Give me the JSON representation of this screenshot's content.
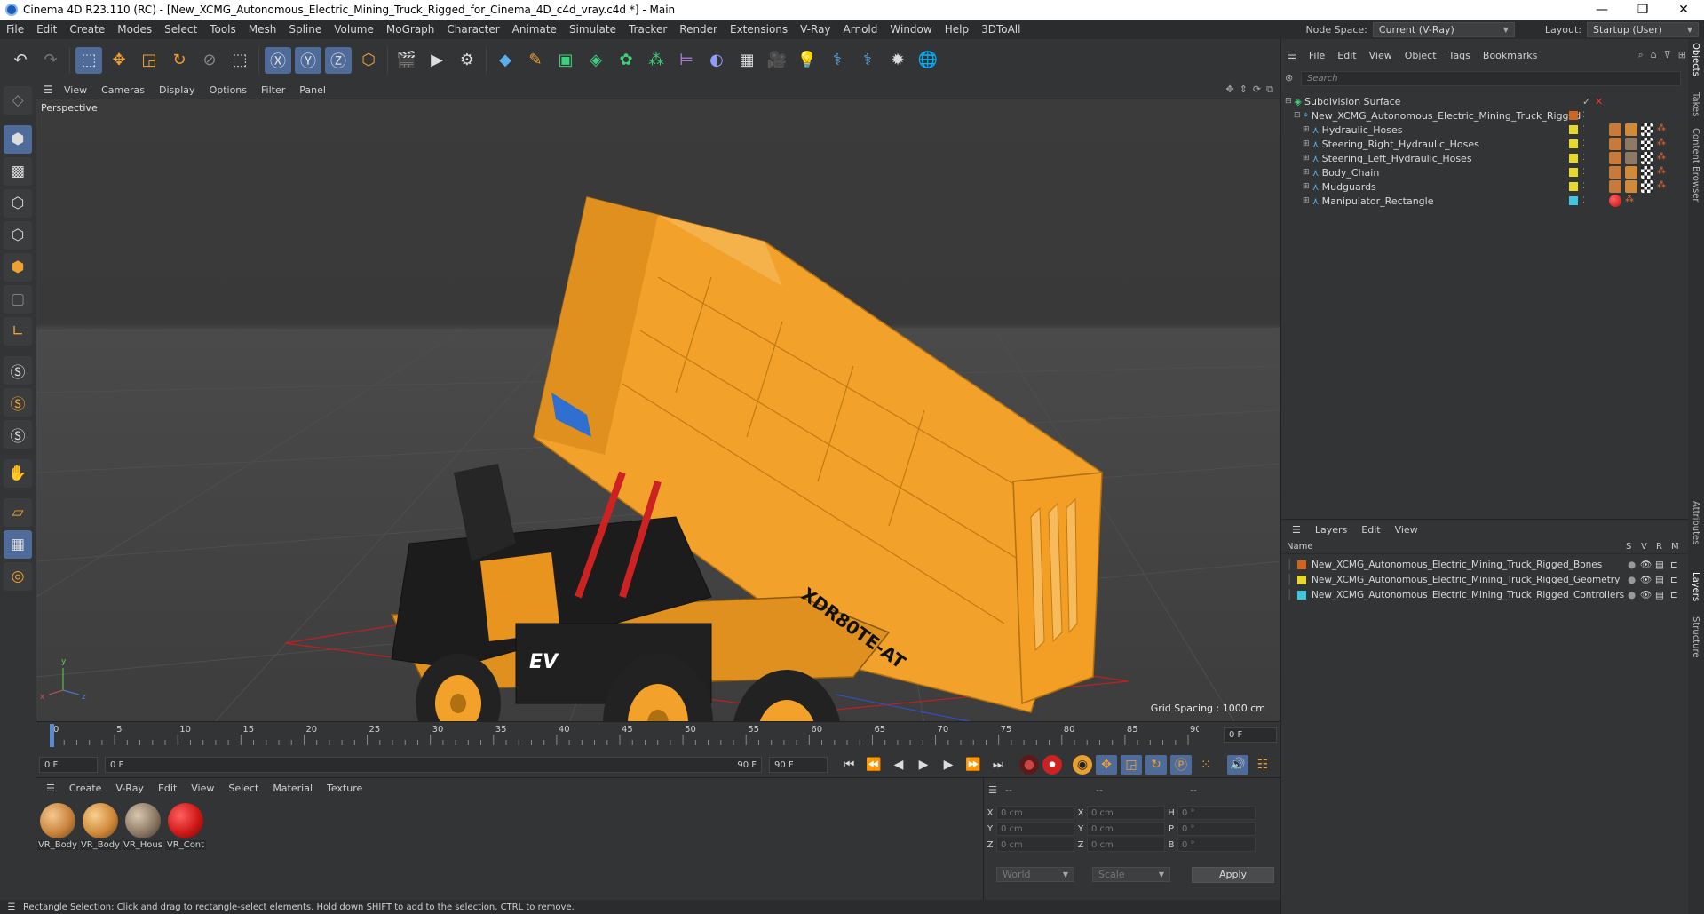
{
  "window": {
    "title": "Cinema 4D R23.110 (RC) - [New_XCMG_Autonomous_Electric_Mining_Truck_Rigged_for_Cinema_4D_c4d_vray.c4d *] - Main",
    "minimize": "—",
    "maximize": "❐",
    "close": "✕"
  },
  "menubar": {
    "items": [
      "File",
      "Edit",
      "Create",
      "Modes",
      "Select",
      "Tools",
      "Mesh",
      "Spline",
      "Volume",
      "MoGraph",
      "Character",
      "Animate",
      "Simulate",
      "Tracker",
      "Render",
      "Extensions",
      "V-Ray",
      "Arnold",
      "Window",
      "Help",
      "3DToAll"
    ],
    "node_space_label": "Node Space:",
    "node_space_value": "Current (V-Ray)",
    "layout_label": "Layout:",
    "layout_value": "Startup (User)"
  },
  "viewport": {
    "menu": [
      "View",
      "Cameras",
      "Display",
      "Options",
      "Filter",
      "Panel"
    ],
    "label": "Perspective",
    "grid_spacing": "Grid Spacing : 1000 cm",
    "truck_text": "XDR80TE-AT",
    "logo_text": "EV",
    "axis_x": "x",
    "axis_y": "y",
    "axis_z": "z"
  },
  "timeline": {
    "ticks": [
      "0",
      "5",
      "10",
      "15",
      "20",
      "25",
      "30",
      "35",
      "40",
      "45",
      "50",
      "55",
      "60",
      "65",
      "70",
      "75",
      "80",
      "85",
      "90"
    ],
    "current_frame": "0 F"
  },
  "transport": {
    "start": "0 F",
    "range_start": "0 F",
    "range_end": "90 F",
    "end": "90 F"
  },
  "material_manager": {
    "menu": [
      "Create",
      "V-Ray",
      "Edit",
      "View",
      "Select",
      "Material",
      "Texture"
    ],
    "materials": [
      {
        "label": "VR_Body",
        "color": "#c8843e"
      },
      {
        "label": "VR_Body",
        "color": "#d08a3a"
      },
      {
        "label": "VR_Hous",
        "color": "#8d7a66"
      },
      {
        "label": "VR_Cont",
        "color": "#d01818"
      }
    ]
  },
  "coordinates": {
    "header": [
      "--",
      "--",
      "--"
    ],
    "rows": [
      {
        "a": "X",
        "av": "0 cm",
        "b": "X",
        "bv": "0 cm",
        "c": "H",
        "cv": "0 °"
      },
      {
        "a": "Y",
        "av": "0 cm",
        "b": "Y",
        "bv": "0 cm",
        "c": "P",
        "cv": "0 °"
      },
      {
        "a": "Z",
        "av": "0 cm",
        "b": "Z",
        "bv": "0 cm",
        "c": "B",
        "cv": "0 °"
      }
    ],
    "world": "World",
    "scale": "Scale",
    "apply": "Apply"
  },
  "status": {
    "text": "Rectangle Selection: Click and drag to rectangle-select elements. Hold down SHIFT to add to the selection, CTRL to remove."
  },
  "object_manager": {
    "menu": [
      "File",
      "Edit",
      "View",
      "Object",
      "Tags",
      "Bookmarks"
    ],
    "search_placeholder": "Search",
    "objects": [
      {
        "name": "Subdivision Surface",
        "swatch": ""
      },
      {
        "name": "New_XCMG_Autonomous_Electric_Mining_Truck_Rigged",
        "swatch": "#d3641e"
      },
      {
        "name": "Hydraulic_Hoses",
        "swatch": "#e8d82a"
      },
      {
        "name": "Steering_Right_Hydraulic_Hoses",
        "swatch": "#e8d82a"
      },
      {
        "name": "Steering_Left_Hydraulic_Hoses",
        "swatch": "#e8d82a"
      },
      {
        "name": "Body_Chain",
        "swatch": "#e8d82a"
      },
      {
        "name": "Mudguards",
        "swatch": "#e8d82a"
      },
      {
        "name": "Manipulator_Rectangle",
        "swatch": "#3ec8e0"
      }
    ]
  },
  "layers": {
    "menu": [
      "Layers",
      "Edit",
      "View"
    ],
    "col_name": "Name",
    "col_s": "S",
    "col_v": "V",
    "col_r": "R",
    "col_m": "M",
    "items": [
      {
        "name": "New_XCMG_Autonomous_Electric_Mining_Truck_Rigged_Bones",
        "color": "#d3641e"
      },
      {
        "name": "New_XCMG_Autonomous_Electric_Mining_Truck_Rigged_Geometry",
        "color": "#e8d82a"
      },
      {
        "name": "New_XCMG_Autonomous_Electric_Mining_Truck_Rigged_Controllers",
        "color": "#3ec8e0"
      }
    ]
  },
  "side_tabs": [
    "Objects",
    "Takes",
    "Content Browser",
    "Attributes",
    "Layers",
    "Structure"
  ]
}
